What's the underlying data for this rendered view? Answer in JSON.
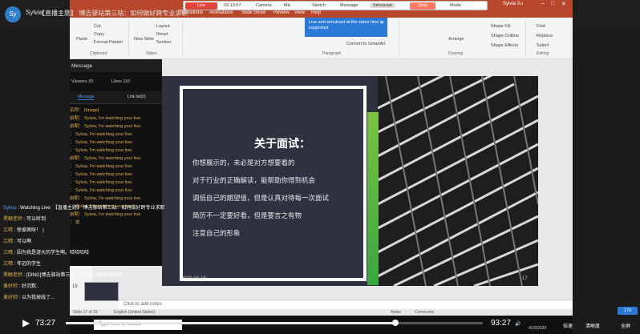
{
  "header": {
    "avatar_initials": "Sy",
    "user": "Sylvia",
    "title": "【直播主题】 博吉驿站第三站：如何做好跨专业求职"
  },
  "ppt": {
    "window_user": "Sylvia Xu",
    "tabs": [
      "Transitions",
      "Animations",
      "Slide Show",
      "Review",
      "View",
      "Help"
    ],
    "livebar": {
      "live": "Live",
      "timer": "03:13:07",
      "camera": "Camera",
      "mic": "Mic",
      "sketch": "Sketch",
      "message": "Message",
      "simulcast": "Simulcast",
      "stop": "Stop",
      "mode": "Mode"
    },
    "tooltip": "Live and simulcast at the same time is supported",
    "ribbon": {
      "paste": "Paste",
      "cut": "Cut",
      "copy": "Copy",
      "format_painter": "Format Painter",
      "clipboard": "Clipboard",
      "new_slide": "New Slide",
      "layout": "Layout",
      "reset": "Reset",
      "section": "Section",
      "slides": "Slides",
      "paragraph": "Paragraph",
      "convert": "Convert to SmartArt",
      "drawing": "Drawing",
      "arrange": "Arrange",
      "shape_fill": "Shape Fill",
      "shape_outline": "Shape Outline",
      "shape_effects": "Shape Effects",
      "find": "Find",
      "replace": "Replace",
      "select": "Select",
      "editing": "Editing"
    },
    "slide": {
      "title": "关于面试：",
      "lines": [
        "你想展示的，未必是对方想要看的",
        "对于行业的正确解读，能帮助你得到机会",
        "调低自己的期望值，但是认真对待每一次面试",
        "简历不一定要好看，但是要言之有物",
        "注意自己的形象"
      ],
      "date": "2020-04-18",
      "page": "17"
    },
    "thumb_num": "19",
    "notes": "Click to add notes",
    "status": "Slide 17 of 19",
    "language": "English (United States)",
    "status_notes": "Notes",
    "status_comments": "Comments"
  },
  "message_panel": {
    "title": "Message",
    "viewers": "Viewers 33",
    "likes": "Likes 110",
    "tab_message": "Message",
    "tab_link": "Link list(0)",
    "lines": [
      "名称： [Image]",
      "前期： Sylvia, I'm watching your live.",
      "前期： Sylvia, I'm watching your live.",
      "： Sylvia, I'm watching your live.",
      "： Sylvia, I'm watching your live.",
      "： Sylvia, I'm watching your live.",
      "前期： Sylvia, I'm watching your live.",
      "： Sylvia, I'm watching your live.",
      "： Sylvia, I'm watching your live.",
      "： Sylvia, I'm watching your live.",
      "： Sylvia, I'm watching your live.",
      "前期： Sylvia, I'm watching your live.",
      "： Sylvia, I'm watching your live.",
      "前期： Sylvia, I'm watching your live.",
      "： 这"
    ]
  },
  "chat": [
    {
      "name": "Sylvia",
      "text": "Watching Live:"
    },
    {
      "name": "",
      "text": "【直播主题】 博吉驿站第三站：如何做好跨专业求职"
    },
    {
      "name": "黑眼老师",
      "text": "可以听到"
    },
    {
      "name": "江晴",
      "text": "徐爱茜呀！ )"
    },
    {
      "name": "江晴",
      "text": "可以啊"
    },
    {
      "name": "江晴",
      "text": "因为我是游大的学生啊。哈哈哈哈"
    },
    {
      "name": "江晴",
      "text": "年迈的学生"
    },
    {
      "name": "黑眼老师",
      "text": "[DING]博吉驿站第三期，我们9:00准时开始哦"
    },
    {
      "name": "黄好帅",
      "text": "好沉默.."
    },
    {
      "name": "黄好帅",
      "text": "以为我掉线了..."
    }
  ],
  "player": {
    "current_time": "73:27",
    "end_time": "93:27",
    "speed": "倍速",
    "quality": "清晰度",
    "fullscreen": "全屏",
    "count": "179",
    "progress": 0.79
  },
  "taskbar": {
    "search_placeholder": "Type here to search",
    "date": "4/18/2020"
  }
}
